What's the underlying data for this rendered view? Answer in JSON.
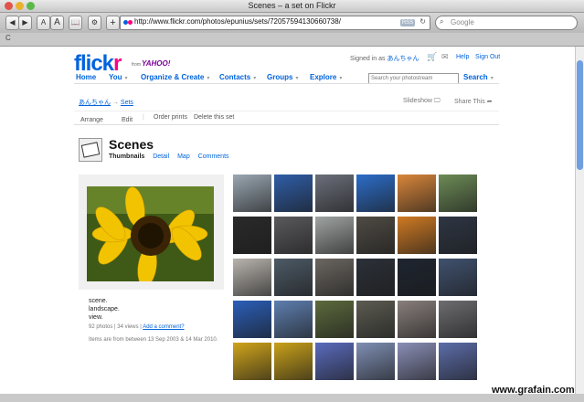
{
  "window": {
    "title": "Scenes – a set on Flickr"
  },
  "toolbar": {
    "back": "◀",
    "forward": "▶",
    "text_smaller": "A",
    "text_bigger": "A",
    "bookmarks_button": "📖",
    "settings_button": "⚙",
    "add_button": "+",
    "url": "http://www.flickr.com/photos/epunius/sets/72057594130660738/",
    "rss_label": "RSS",
    "search_placeholder": "Google"
  },
  "bookmarks_bar": {
    "item": "C"
  },
  "header": {
    "logo_main": "flick",
    "logo_accent": "r",
    "from_label": "from",
    "yahoo": "YAHOO!",
    "signed_in_prefix": "Signed in as",
    "user": "あんちゃん",
    "help": "Help",
    "sign_out": "Sign Out"
  },
  "nav": {
    "items": [
      {
        "label": "Home"
      },
      {
        "label": "You"
      },
      {
        "label": "Organize & Create"
      },
      {
        "label": "Contacts"
      },
      {
        "label": "Groups"
      },
      {
        "label": "Explore"
      }
    ],
    "search_placeholder": "Search your photostream",
    "search_label": "Search"
  },
  "breadcrumb": {
    "user": "あんちゃん",
    "separator": "→",
    "sets": "Sets"
  },
  "set_actions": {
    "slideshow": "Slideshow",
    "share": "Share This"
  },
  "action_bar": {
    "arrange": "Arrange",
    "edit": "Edit",
    "divider": "|",
    "order_prints": "Order prints",
    "delete": "Delete this set"
  },
  "set": {
    "title": "Scenes",
    "tabs": [
      {
        "label": "Thumbnails"
      },
      {
        "label": "Detail"
      },
      {
        "label": "Map"
      },
      {
        "label": "Comments"
      }
    ],
    "description": [
      "scene.",
      "landscape.",
      "view."
    ],
    "stats_photos": "92 photos",
    "stats_sep": "|",
    "stats_views": "34 views",
    "add_comment": "Add a comment?",
    "dates": "Items are from between 13 Sep 2003 & 14 Mar 2010."
  },
  "thumbnails": {
    "colors": [
      [
        "#9aa7b2",
        "#2f5ea8",
        "#6b6f7a",
        "#2c6dc9",
        "#d9863a",
        "#6c8b56"
      ],
      [
        "#2a2a2a",
        "#5a5a5e",
        "#a0a4a3",
        "#4f4b44",
        "#cf7a23",
        "#2e3644"
      ],
      [
        "#b9b4ae",
        "#4d5a66",
        "#6b6660",
        "#2c3038",
        "#1e2530",
        "#40526f"
      ],
      [
        "#2b5fb9",
        "#5e7fb0",
        "#5c6a3d",
        "#5c5c52",
        "#897f7c",
        "#6d6d70"
      ],
      [
        "#d0a51b",
        "#c9a11a",
        "#5a6bbd",
        "#7f8fb4",
        "#8a8fb6",
        "#5c6da9"
      ]
    ]
  },
  "watermark": "www.grafain.com"
}
